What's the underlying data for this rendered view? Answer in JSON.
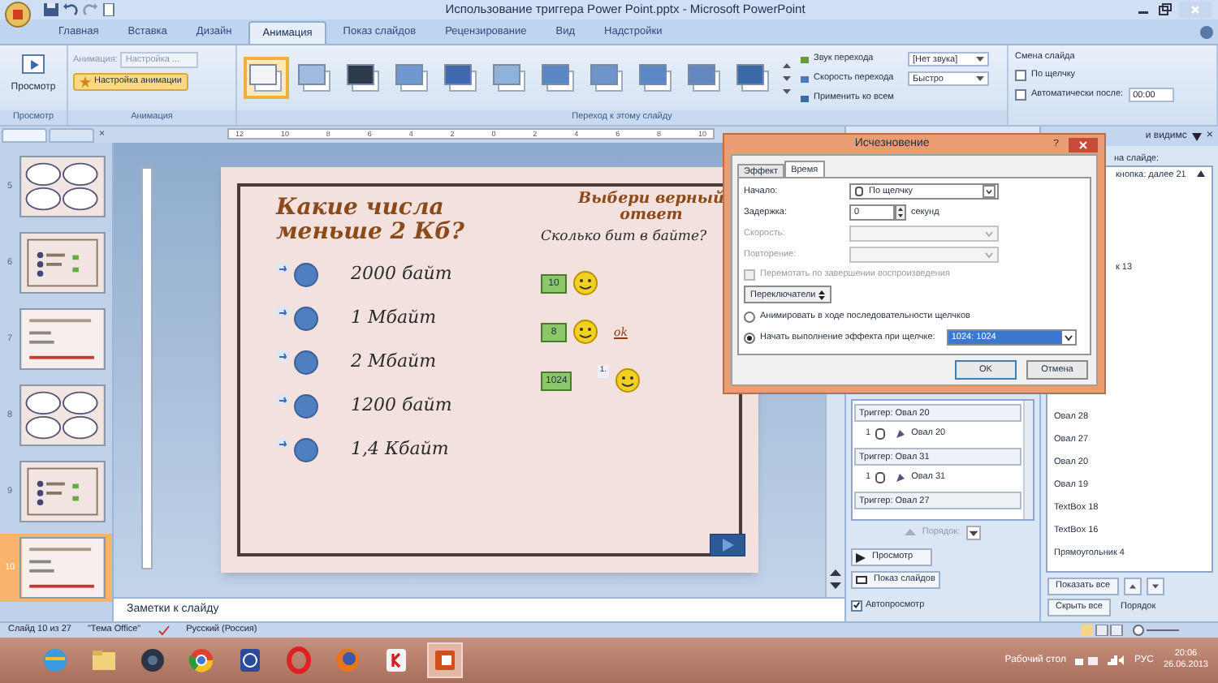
{
  "window": {
    "title": "Использование триггера Power Point.pptx - Microsoft PowerPoint"
  },
  "ribbon_tabs": [
    {
      "label": "Главная",
      "selected": false
    },
    {
      "label": "Вставка",
      "selected": false
    },
    {
      "label": "Дизайн",
      "selected": false
    },
    {
      "label": "Анимация",
      "selected": true
    },
    {
      "label": "Показ слайдов",
      "selected": false
    },
    {
      "label": "Рецензирование",
      "selected": false
    },
    {
      "label": "Вид",
      "selected": false
    },
    {
      "label": "Надстройки",
      "selected": false
    }
  ],
  "ribbon": {
    "preview": {
      "button": "Просмотр",
      "group": "Просмотр"
    },
    "animation": {
      "label": "Анимация:",
      "value": "Настройка ...",
      "custom_button": "Настройка анимации",
      "group": "Анимация"
    },
    "transitions": {
      "group": "Переход к этому слайду",
      "items": [
        {
          "selected": true
        },
        {
          "selected": false
        },
        {
          "selected": false
        },
        {
          "selected": false
        },
        {
          "selected": false
        },
        {
          "selected": false
        },
        {
          "selected": false
        },
        {
          "selected": false
        },
        {
          "selected": false
        },
        {
          "selected": false
        },
        {
          "selected": false
        }
      ]
    },
    "sound": {
      "label": "Звук перехода",
      "value": "[Нет звука]"
    },
    "speed": {
      "label": "Скорость перехода",
      "value": "Быстро"
    },
    "apply_all": "Применить ко всем",
    "advance": {
      "group": "Смена слайда",
      "on_click": {
        "label": "По щелчку",
        "checked": false
      },
      "auto_after": {
        "label": "Автоматически после:",
        "checked": false,
        "value": "00:00"
      }
    }
  },
  "pane_close": "×",
  "ruler_labels": [
    "12",
    "10",
    "8",
    "6",
    "4",
    "2",
    "0",
    "2",
    "4",
    "6",
    "8",
    "10"
  ],
  "thumbnails": [
    {
      "number": "5",
      "selected": false
    },
    {
      "number": "6",
      "selected": false
    },
    {
      "number": "7",
      "selected": false
    },
    {
      "number": "8",
      "selected": false
    },
    {
      "number": "9",
      "selected": false
    },
    {
      "number": "10",
      "selected": true
    }
  ],
  "slide": {
    "question": "Какие числа меньше 2 Кб?",
    "options": [
      "2000 байт",
      "1 Мбайт",
      "2 Мбайт",
      "1200 байт",
      "1,4 Кбайт"
    ],
    "prompt": "Выбери верный ответ",
    "subprompt": "Сколько бит в байте?",
    "answers": [
      {
        "value": "10"
      },
      {
        "value": "8",
        "note": "ok"
      },
      {
        "value": "1024",
        "badge": "1."
      }
    ]
  },
  "notes_placeholder": "Заметки к слайду",
  "dialog": {
    "title": "Исчезновение",
    "tabs": [
      {
        "label": "Эффект",
        "selected": false
      },
      {
        "label": "Время",
        "selected": true
      }
    ],
    "start": {
      "label": "Начало:",
      "value": "По щелчку"
    },
    "delay": {
      "label": "Задержка:",
      "value": "0",
      "unit": "секунд"
    },
    "speed": {
      "label": "Скорость:",
      "disabled": true
    },
    "repeat": {
      "label": "Повторение:",
      "disabled": true
    },
    "rewind": {
      "label": "Перемотать по завершении воспроизведения",
      "checked": false,
      "disabled": true
    },
    "triggers_button": "Переключатели",
    "options": [
      {
        "label": "Анимировать в ходе последовательности щелчков",
        "selected": false
      },
      {
        "label": "Начать выполнение эффекта при щелчке:",
        "selected": true,
        "value": "1024: 1024"
      }
    ],
    "help": "?",
    "buttons": [
      "OK",
      "Отмена"
    ]
  },
  "custom_animation": {
    "items": [
      {
        "kind": "trigger",
        "label": "Триггер: Овал 20"
      },
      {
        "kind": "effect",
        "order": "1",
        "label": "Овал 20"
      },
      {
        "kind": "trigger",
        "label": "Триггер: Овал 31"
      },
      {
        "kind": "effect",
        "order": "1",
        "label": "Овал 31"
      },
      {
        "kind": "trigger",
        "label": "Триггер: Овал 27"
      }
    ],
    "reorder_label": "Порядок:",
    "preview_button": "Просмотр",
    "slideshow_button": "Показ слайдов",
    "autopreview": {
      "label": "Автопросмотр",
      "checked": true
    }
  },
  "selection_pane": {
    "title": "и видимс",
    "close": "×",
    "caption": "на слайде:",
    "items_top": [
      "кнопка: далее 21",
      "к 13"
    ],
    "items": [
      "Овал 28",
      "Овал 27",
      "Овал 20",
      "Овал 19",
      "TextBox 18",
      "TextBox 16",
      "Прямоугольник 4"
    ],
    "show_all": "Показать все",
    "hide_all": "Скрыть все",
    "reorder_label": "Порядок"
  },
  "status_bar": {
    "slide": "Слайд 10 из 27",
    "theme": "\"Тема Office\"",
    "language": "Русский (Россия)"
  },
  "taskbar": {
    "desktop_label": "Рабочий стол",
    "language": "РУС",
    "time": "20:06",
    "date": "26.06.2013"
  }
}
